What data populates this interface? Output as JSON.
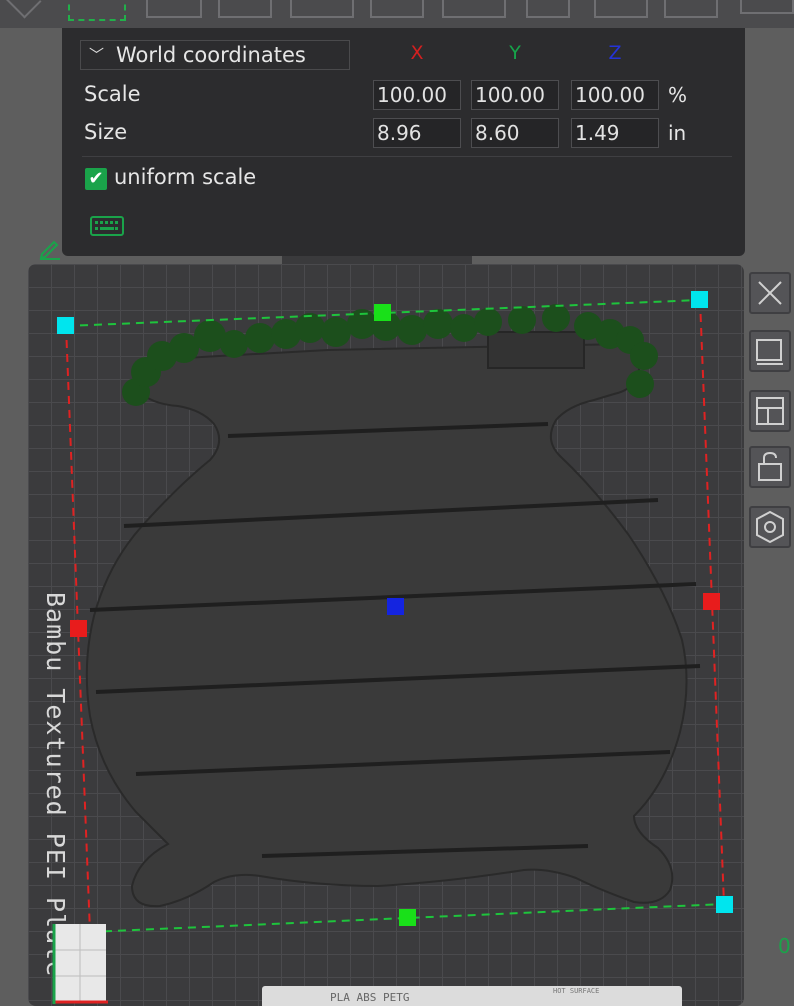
{
  "panel": {
    "coord_system": "World coordinates",
    "axes": {
      "x": "X",
      "y": "Y",
      "z": "Z"
    },
    "scale": {
      "label": "Scale",
      "x": "100.00",
      "y": "100.00",
      "z": "100.00",
      "unit": "%"
    },
    "size": {
      "label": "Size",
      "x": "8.96",
      "y": "8.60",
      "z": "1.49",
      "unit": "in"
    },
    "uniform_scale": {
      "label": "uniform scale",
      "checked": true
    }
  },
  "plate": {
    "label": "Bambu Textured PEI Plate",
    "footer_text": "PLA ABS PETG",
    "footer_small": "HOT SURFACE"
  },
  "edge_readout": "0",
  "colors": {
    "axis_x": "#d42020",
    "axis_y": "#16a44a",
    "axis_z": "#2433d8",
    "accent": "#1aa34a",
    "handle_corner": "#00e5ee",
    "model": "#3a3a3a",
    "bubbles": "#1c4f1c"
  },
  "icons": [
    "pencil-icon",
    "keyboard-icon",
    "close-icon",
    "auto-orient-icon",
    "arrange-icon",
    "lock-icon",
    "nut-icon",
    "chevron-down-icon",
    "checkmark-icon"
  ]
}
